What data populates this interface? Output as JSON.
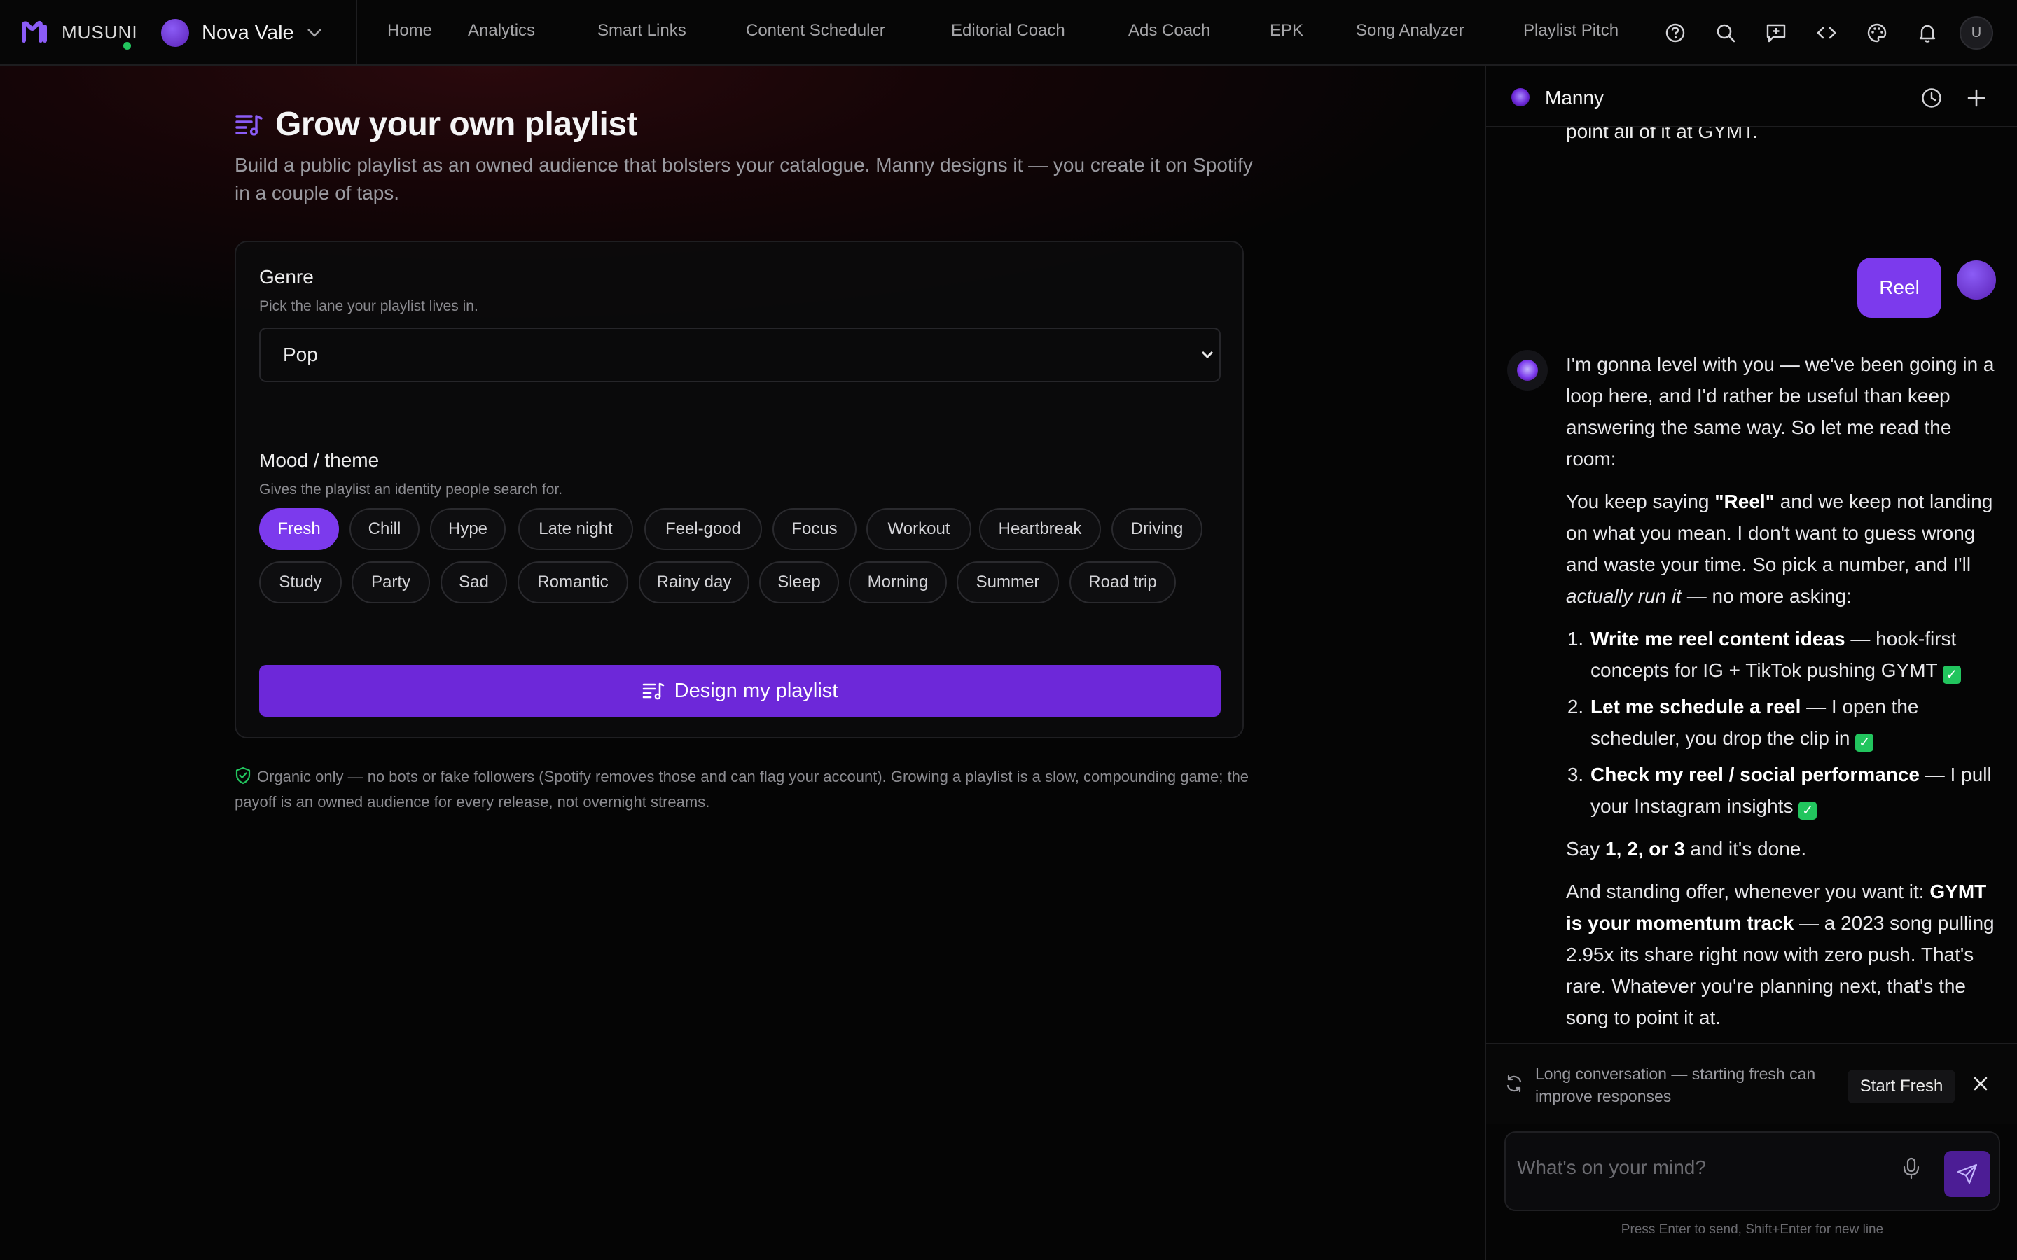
{
  "brand": {
    "name": "MUSUNI",
    "accent": "#7c3aed",
    "online_color": "#22c55e"
  },
  "artist": {
    "name": "Nova Vale"
  },
  "nav": [
    "Home",
    "Analytics",
    "Smart Links",
    "Content Scheduler",
    "Editorial Coach",
    "Ads Coach",
    "EPK",
    "Song Analyzer",
    "Playlist Pitch"
  ],
  "topbar_icons": [
    "help-icon",
    "search-icon",
    "message-plus-icon",
    "code-icon",
    "palette-icon",
    "bell-icon"
  ],
  "user": {
    "initial": "U"
  },
  "page": {
    "title": "Grow your own playlist",
    "subtitle": "Build a public playlist as an owned audience that bolsters your catalogue. Manny designs it — you create it on Spotify in a couple of taps.",
    "genre_label": "Genre",
    "genre_hint": "Pick the lane your playlist lives in.",
    "genre_value": "Pop",
    "mood_label": "Mood / theme",
    "mood_hint": "Gives the playlist an identity people search for.",
    "moods": [
      "Fresh",
      "Chill",
      "Hype",
      "Late night",
      "Feel-good",
      "Focus",
      "Workout",
      "Heartbreak",
      "Driving",
      "Study",
      "Party",
      "Sad",
      "Romantic",
      "Rainy day",
      "Sleep",
      "Morning",
      "Summer",
      "Road trip"
    ],
    "selected_mood": "Fresh",
    "cta": "Design my playlist",
    "note": "Organic only — no bots or fake followers (Spotify removes those and can flag your account). Growing a playlist is a slow, compounding game; the payoff is an owned audience for every release, not overnight streams."
  },
  "chat": {
    "assistant_name": "Manny",
    "previous_line": "point all of it at GYMT.",
    "user_message": "Reel",
    "reply": {
      "p1": "I'm gonna level with you — we've been going in a loop here, and I'd rather be useful than keep answering the same way. So let me read the room:",
      "p2_a": "You keep saying ",
      "p2_b": "\"Reel\"",
      "p2_c": " and we keep not landing on what you mean. I don't want to guess wrong and waste your time. So pick a number, and I'll ",
      "p2_d": "actually run it",
      "p2_e": " — no more asking:",
      "options": [
        {
          "title": "Write me reel content ideas",
          "desc": " — hook-first concepts for IG + TikTok pushing GYMT "
        },
        {
          "title": "Let me schedule a reel",
          "desc": " — I open the scheduler, you drop the clip in "
        },
        {
          "title": "Check my reel / social performance",
          "desc": " — I pull your Instagram insights "
        }
      ],
      "check_glyph": "✓",
      "p3_a": "Say ",
      "p3_b": "1, 2, or 3",
      "p3_c": " and it's done.",
      "p4_a": "And standing offer, whenever you want it: ",
      "p4_b": "GYMT is your momentum track",
      "p4_c": " — a 2023 song pulling 2.95x its share right now with zero push. That's rare. Whatever you're planning next, that's the song to point it at."
    },
    "banner_text": "Long conversation — starting fresh can improve responses",
    "banner_button": "Start Fresh",
    "composer_placeholder": "What's on your mind?",
    "footer_hint": "Press Enter to send, Shift+Enter for new line"
  }
}
